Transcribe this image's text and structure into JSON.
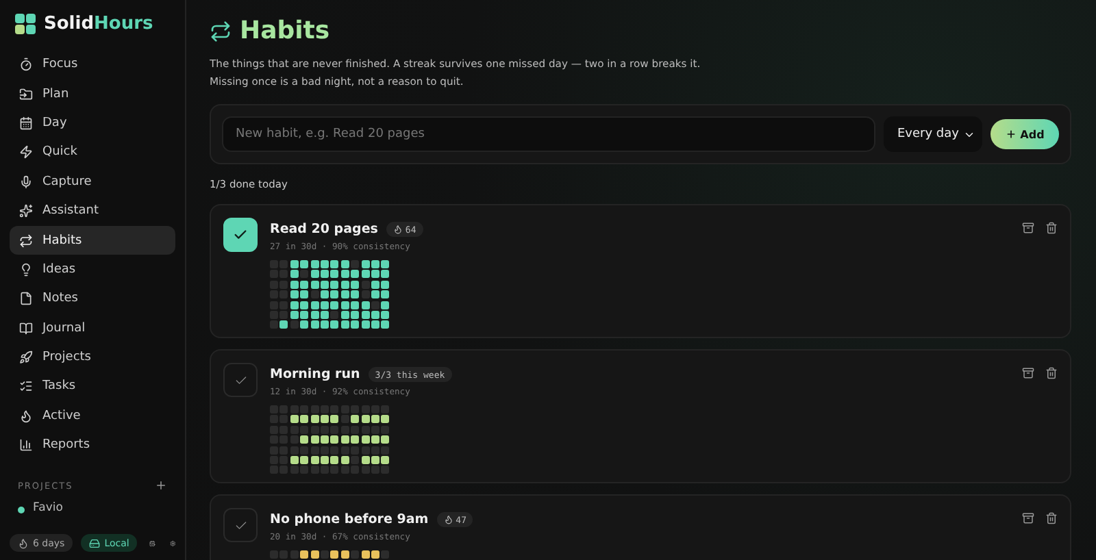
{
  "app": {
    "brand_first": "Solid",
    "brand_second": "Hours"
  },
  "sidebar": {
    "items": [
      {
        "label": "Focus",
        "selected": false
      },
      {
        "label": "Plan",
        "selected": false
      },
      {
        "label": "Day",
        "selected": false
      },
      {
        "label": "Quick",
        "selected": false
      },
      {
        "label": "Capture",
        "selected": false
      },
      {
        "label": "Assistant",
        "selected": false
      },
      {
        "label": "Habits",
        "selected": true
      },
      {
        "label": "Ideas",
        "selected": false
      },
      {
        "label": "Notes",
        "selected": false
      },
      {
        "label": "Journal",
        "selected": false
      },
      {
        "label": "Projects",
        "selected": false
      },
      {
        "label": "Tasks",
        "selected": false
      },
      {
        "label": "Active",
        "selected": false
      },
      {
        "label": "Reports",
        "selected": false
      }
    ],
    "projects_heading": "PROJECTS",
    "projects": [
      {
        "name": "Favio",
        "color": "#5ed6b4"
      }
    ],
    "streak": "6 days",
    "storage": "Local"
  },
  "page": {
    "title": "Habits",
    "description": [
      "The things that are never finished. A streak survives one missed day — two in a row breaks it.",
      "Missing once is a bad night, not a reason to quit."
    ],
    "new_habit": {
      "placeholder": "New habit, e.g. Read 20 pages",
      "frequency": "Every day",
      "add_label": "Add"
    },
    "progress": "1/3 done today"
  },
  "habits": [
    {
      "name": "Read 20 pages",
      "done": true,
      "kind": "streak",
      "badge": "64",
      "stats": "27 in 30d · 90% consistency",
      "color": "#5ed6b4",
      "grid": [
        [
          false,
          false,
          true,
          true,
          true,
          true,
          true,
          true,
          false,
          true,
          true,
          true
        ],
        [
          false,
          false,
          true,
          false,
          true,
          true,
          true,
          true,
          true,
          true,
          true,
          true
        ],
        [
          false,
          false,
          true,
          true,
          true,
          true,
          true,
          true,
          true,
          false,
          true,
          true
        ],
        [
          false,
          false,
          true,
          true,
          false,
          true,
          true,
          true,
          true,
          false,
          true,
          true
        ],
        [
          false,
          false,
          true,
          true,
          true,
          true,
          true,
          true,
          true,
          true,
          false,
          true
        ],
        [
          false,
          false,
          true,
          true,
          true,
          true,
          false,
          true,
          true,
          true,
          true,
          true
        ],
        [
          false,
          true,
          false,
          true,
          true,
          true,
          true,
          true,
          true,
          true,
          true,
          true
        ]
      ]
    },
    {
      "name": "Morning run",
      "done": false,
      "kind": "week",
      "badge": "3/3 this week",
      "stats": "12 in 30d · 92% consistency",
      "color": "#b5dc8a",
      "grid": [
        [
          false,
          false,
          false,
          false,
          false,
          false,
          false,
          false,
          false,
          false,
          false,
          false
        ],
        [
          false,
          false,
          true,
          true,
          true,
          true,
          true,
          false,
          true,
          true,
          true,
          true
        ],
        [
          false,
          false,
          false,
          false,
          false,
          false,
          false,
          false,
          false,
          false,
          false,
          false
        ],
        [
          false,
          false,
          false,
          true,
          true,
          true,
          true,
          true,
          true,
          true,
          true,
          true
        ],
        [
          false,
          false,
          false,
          false,
          false,
          false,
          false,
          false,
          false,
          false,
          false,
          false
        ],
        [
          false,
          false,
          true,
          true,
          true,
          true,
          true,
          true,
          false,
          true,
          true,
          true
        ],
        [
          false,
          false,
          false,
          false,
          false,
          false,
          false,
          false,
          false,
          false,
          false,
          false
        ]
      ]
    },
    {
      "name": "No phone before 9am",
      "done": false,
      "kind": "streak",
      "badge": "47",
      "stats": "20 in 30d · 67% consistency",
      "color": "#e8c15c",
      "grid": [
        [
          false,
          false,
          false,
          true,
          true,
          false,
          true,
          true,
          false,
          true,
          true,
          false
        ]
      ]
    }
  ]
}
